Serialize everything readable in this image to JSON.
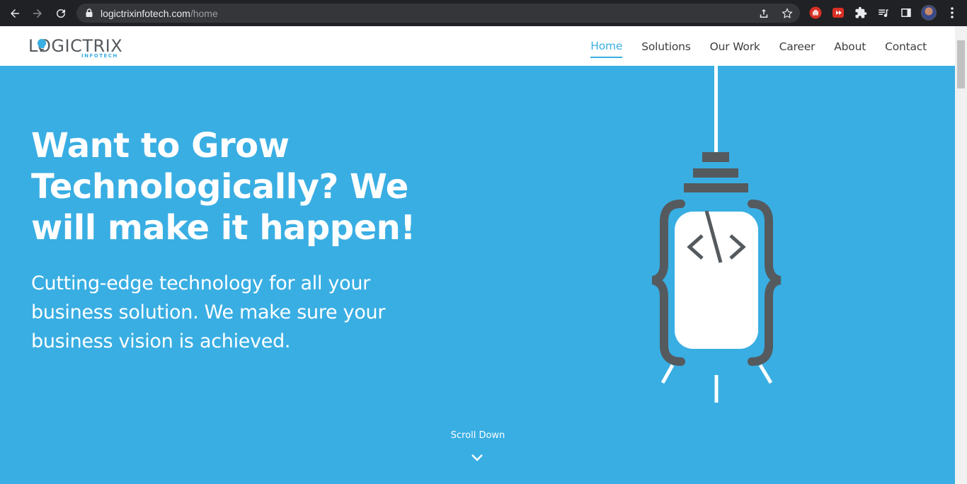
{
  "browser": {
    "url_domain": "logictrixinfotech.com",
    "url_path": "/home"
  },
  "site": {
    "logo_text": "LOGICTRIX",
    "logo_subtext": "INFOTECH",
    "nav": [
      {
        "label": "Home",
        "active": true
      },
      {
        "label": "Solutions",
        "active": false
      },
      {
        "label": "Our Work",
        "active": false
      },
      {
        "label": "Career",
        "active": false
      },
      {
        "label": "About",
        "active": false
      },
      {
        "label": "Contact",
        "active": false
      }
    ]
  },
  "hero": {
    "title": "Want to Grow Technologically? We will make it happen!",
    "subtitle": "Cutting-edge technology for all your business solution. We make sure your business vision is achieved.",
    "scroll_label": "Scroll Down",
    "code_symbol": "</>"
  },
  "colors": {
    "brand_blue": "#39aee3",
    "dark_gray": "#555a5e",
    "white": "#ffffff"
  }
}
